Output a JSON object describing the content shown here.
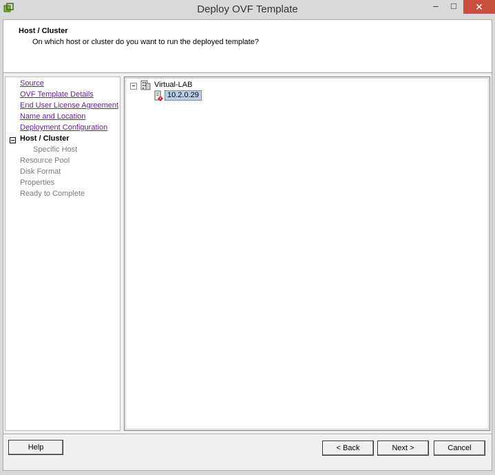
{
  "window": {
    "title": "Deploy OVF Template",
    "controls": {
      "minimize": "–",
      "maximize": "□",
      "close": "✕"
    }
  },
  "header": {
    "title": "Host / Cluster",
    "subtitle": "On which host or cluster do you want to run the deployed template?"
  },
  "nav": {
    "items": [
      {
        "label": "Source",
        "state": "completed"
      },
      {
        "label": "OVF Template Details",
        "state": "completed"
      },
      {
        "label": "End User License Agreement",
        "state": "completed"
      },
      {
        "label": "Name and Location",
        "state": "completed"
      },
      {
        "label": "Deployment Configuration",
        "state": "completed"
      },
      {
        "label": "Host / Cluster",
        "state": "current"
      },
      {
        "label": "Specific Host",
        "state": "pending"
      },
      {
        "label": "Resource Pool",
        "state": "pending"
      },
      {
        "label": "Disk Format",
        "state": "pending"
      },
      {
        "label": "Properties",
        "state": "pending"
      },
      {
        "label": "Ready to Complete",
        "state": "pending"
      }
    ]
  },
  "tree": {
    "datacenter": {
      "label": "Virtual-LAB",
      "icon": "datacenter-icon",
      "expanded": true
    },
    "host": {
      "label": "10.2.0.29",
      "icon": "host-warning-icon",
      "selected": true
    }
  },
  "buttons": {
    "help": "Help",
    "back": "< Back",
    "next": "Next >",
    "cancel": "Cancel"
  },
  "colors": {
    "link": "#6b1e8c",
    "close_button": "#c7503f",
    "selection": "#b8cfe6",
    "pending_text": "#7a7a7a"
  }
}
